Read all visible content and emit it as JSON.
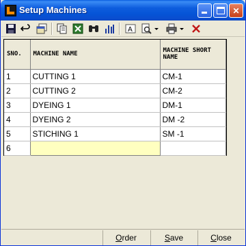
{
  "window": {
    "title": "Setup Machines"
  },
  "toolbar": {
    "icons": [
      "save-icon",
      "undo-icon",
      "window-icon",
      "copy-icon",
      "excel-icon",
      "find-icon",
      "chart-icon",
      "text-icon",
      "preview-icon",
      "print-icon",
      "delete-icon"
    ]
  },
  "grid": {
    "columns": [
      "SNO.",
      "MACHINE NAME",
      "MACHINE SHORT NAME"
    ],
    "rows": [
      {
        "sno": "1",
        "name": "CUTTING 1",
        "short": "CM-1"
      },
      {
        "sno": "2",
        "name": "CUTTING 2",
        "short": "CM-2"
      },
      {
        "sno": "3",
        "name": "DYEING 1",
        "short": "DM-1"
      },
      {
        "sno": "4",
        "name": "DYEING 2",
        "short": "DM -2"
      },
      {
        "sno": "5",
        "name": "STICHING 1",
        "short": "SM -1"
      },
      {
        "sno": "6",
        "name": "",
        "short": ""
      }
    ]
  },
  "buttons": {
    "order_key": "O",
    "order_rest": "rder",
    "save_key": "S",
    "save_rest": "ave",
    "close_key": "C",
    "close_rest": "lose"
  },
  "colors": {
    "title_bar": "#0554d6",
    "active_cell": "#ffffc0",
    "window_bg": "#ece9d8"
  }
}
